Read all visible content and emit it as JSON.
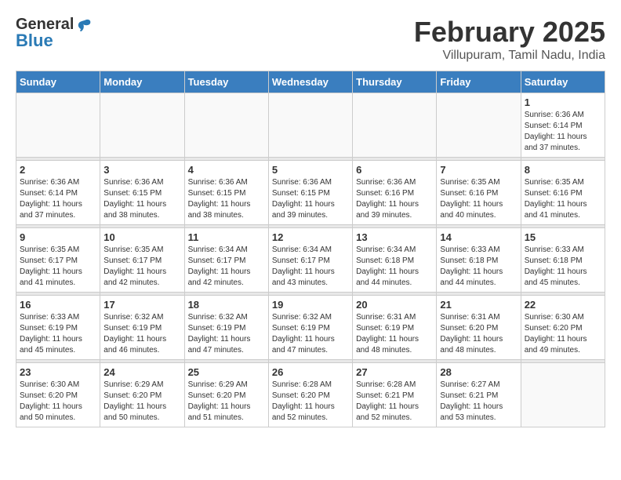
{
  "header": {
    "logo_general": "General",
    "logo_blue": "Blue",
    "month_year": "February 2025",
    "location": "Villupuram, Tamil Nadu, India"
  },
  "weekdays": [
    "Sunday",
    "Monday",
    "Tuesday",
    "Wednesday",
    "Thursday",
    "Friday",
    "Saturday"
  ],
  "weeks": [
    [
      {
        "day": "",
        "info": ""
      },
      {
        "day": "",
        "info": ""
      },
      {
        "day": "",
        "info": ""
      },
      {
        "day": "",
        "info": ""
      },
      {
        "day": "",
        "info": ""
      },
      {
        "day": "",
        "info": ""
      },
      {
        "day": "1",
        "info": "Sunrise: 6:36 AM\nSunset: 6:14 PM\nDaylight: 11 hours\nand 37 minutes."
      }
    ],
    [
      {
        "day": "2",
        "info": "Sunrise: 6:36 AM\nSunset: 6:14 PM\nDaylight: 11 hours\nand 37 minutes."
      },
      {
        "day": "3",
        "info": "Sunrise: 6:36 AM\nSunset: 6:15 PM\nDaylight: 11 hours\nand 38 minutes."
      },
      {
        "day": "4",
        "info": "Sunrise: 6:36 AM\nSunset: 6:15 PM\nDaylight: 11 hours\nand 38 minutes."
      },
      {
        "day": "5",
        "info": "Sunrise: 6:36 AM\nSunset: 6:15 PM\nDaylight: 11 hours\nand 39 minutes."
      },
      {
        "day": "6",
        "info": "Sunrise: 6:36 AM\nSunset: 6:16 PM\nDaylight: 11 hours\nand 39 minutes."
      },
      {
        "day": "7",
        "info": "Sunrise: 6:35 AM\nSunset: 6:16 PM\nDaylight: 11 hours\nand 40 minutes."
      },
      {
        "day": "8",
        "info": "Sunrise: 6:35 AM\nSunset: 6:16 PM\nDaylight: 11 hours\nand 41 minutes."
      }
    ],
    [
      {
        "day": "9",
        "info": "Sunrise: 6:35 AM\nSunset: 6:17 PM\nDaylight: 11 hours\nand 41 minutes."
      },
      {
        "day": "10",
        "info": "Sunrise: 6:35 AM\nSunset: 6:17 PM\nDaylight: 11 hours\nand 42 minutes."
      },
      {
        "day": "11",
        "info": "Sunrise: 6:34 AM\nSunset: 6:17 PM\nDaylight: 11 hours\nand 42 minutes."
      },
      {
        "day": "12",
        "info": "Sunrise: 6:34 AM\nSunset: 6:17 PM\nDaylight: 11 hours\nand 43 minutes."
      },
      {
        "day": "13",
        "info": "Sunrise: 6:34 AM\nSunset: 6:18 PM\nDaylight: 11 hours\nand 44 minutes."
      },
      {
        "day": "14",
        "info": "Sunrise: 6:33 AM\nSunset: 6:18 PM\nDaylight: 11 hours\nand 44 minutes."
      },
      {
        "day": "15",
        "info": "Sunrise: 6:33 AM\nSunset: 6:18 PM\nDaylight: 11 hours\nand 45 minutes."
      }
    ],
    [
      {
        "day": "16",
        "info": "Sunrise: 6:33 AM\nSunset: 6:19 PM\nDaylight: 11 hours\nand 45 minutes."
      },
      {
        "day": "17",
        "info": "Sunrise: 6:32 AM\nSunset: 6:19 PM\nDaylight: 11 hours\nand 46 minutes."
      },
      {
        "day": "18",
        "info": "Sunrise: 6:32 AM\nSunset: 6:19 PM\nDaylight: 11 hours\nand 47 minutes."
      },
      {
        "day": "19",
        "info": "Sunrise: 6:32 AM\nSunset: 6:19 PM\nDaylight: 11 hours\nand 47 minutes."
      },
      {
        "day": "20",
        "info": "Sunrise: 6:31 AM\nSunset: 6:19 PM\nDaylight: 11 hours\nand 48 minutes."
      },
      {
        "day": "21",
        "info": "Sunrise: 6:31 AM\nSunset: 6:20 PM\nDaylight: 11 hours\nand 48 minutes."
      },
      {
        "day": "22",
        "info": "Sunrise: 6:30 AM\nSunset: 6:20 PM\nDaylight: 11 hours\nand 49 minutes."
      }
    ],
    [
      {
        "day": "23",
        "info": "Sunrise: 6:30 AM\nSunset: 6:20 PM\nDaylight: 11 hours\nand 50 minutes."
      },
      {
        "day": "24",
        "info": "Sunrise: 6:29 AM\nSunset: 6:20 PM\nDaylight: 11 hours\nand 50 minutes."
      },
      {
        "day": "25",
        "info": "Sunrise: 6:29 AM\nSunset: 6:20 PM\nDaylight: 11 hours\nand 51 minutes."
      },
      {
        "day": "26",
        "info": "Sunrise: 6:28 AM\nSunset: 6:20 PM\nDaylight: 11 hours\nand 52 minutes."
      },
      {
        "day": "27",
        "info": "Sunrise: 6:28 AM\nSunset: 6:21 PM\nDaylight: 11 hours\nand 52 minutes."
      },
      {
        "day": "28",
        "info": "Sunrise: 6:27 AM\nSunset: 6:21 PM\nDaylight: 11 hours\nand 53 minutes."
      },
      {
        "day": "",
        "info": ""
      }
    ]
  ]
}
